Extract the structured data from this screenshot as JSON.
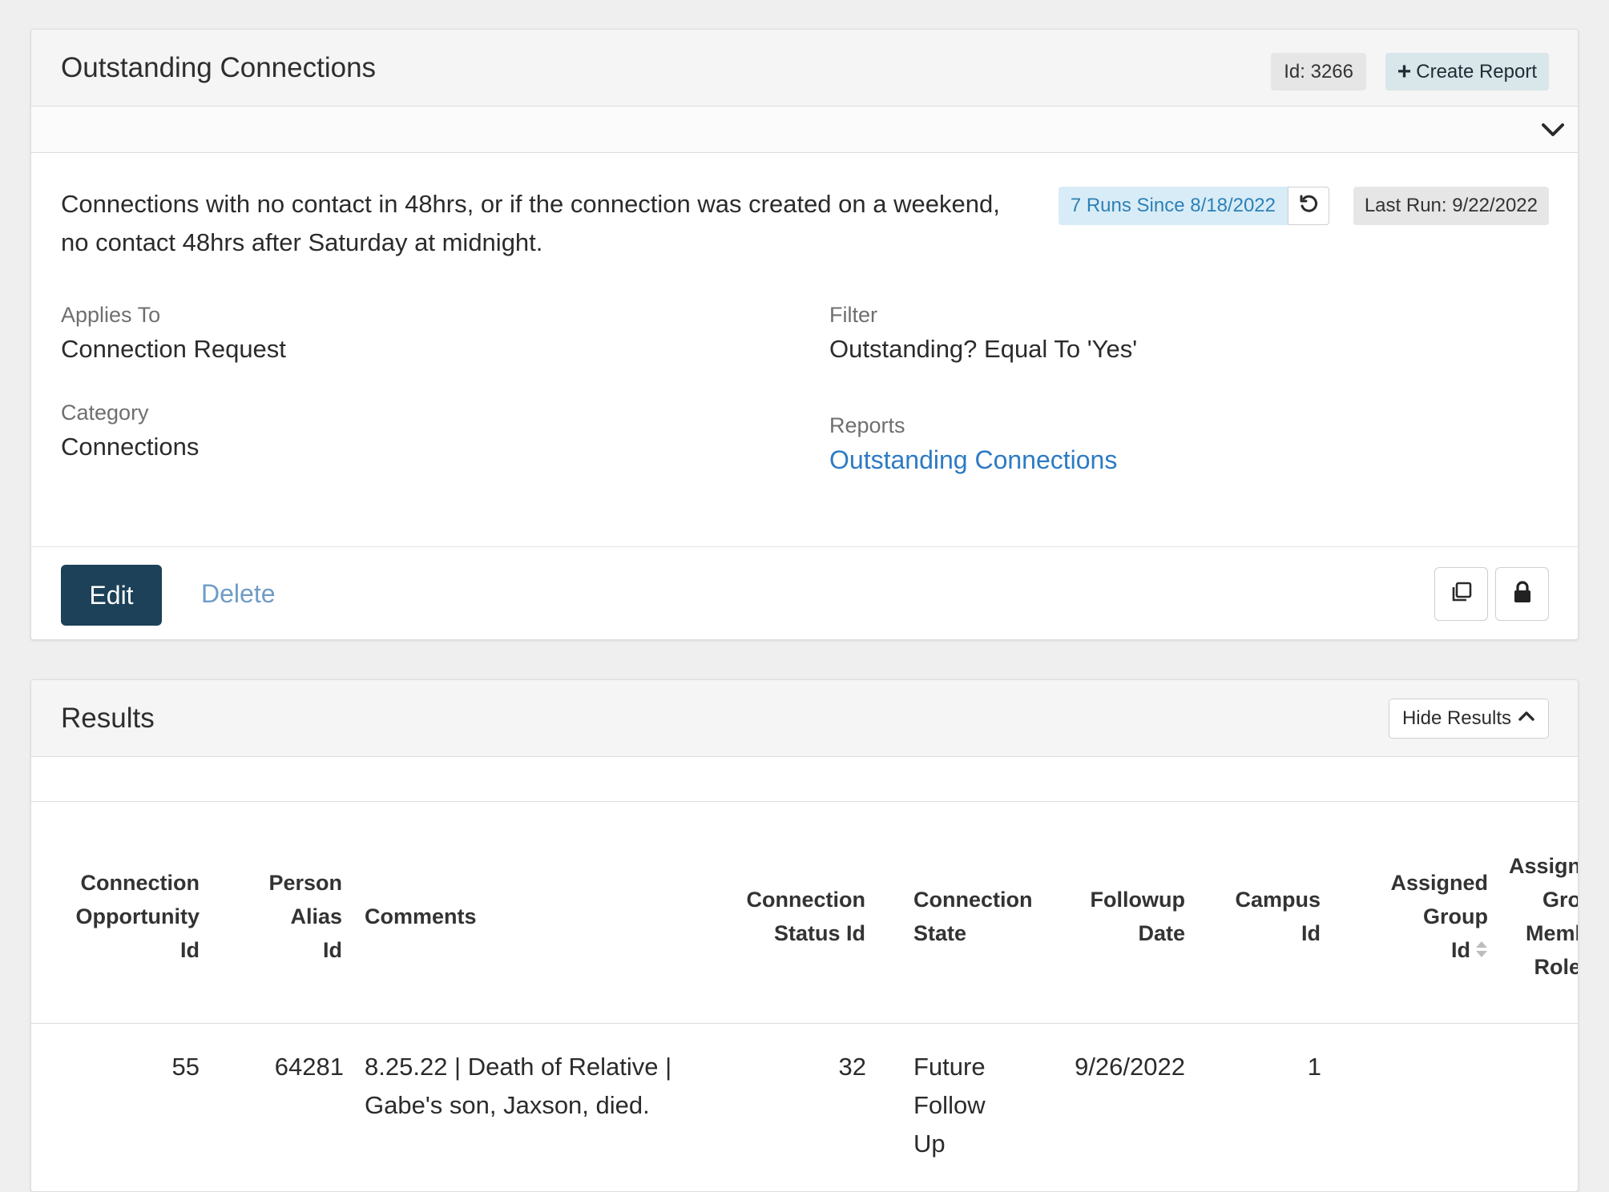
{
  "report_panel": {
    "title": "Outstanding Connections",
    "id_label": "Id: 3266",
    "create_report_label": "Create Report",
    "description": "Connections with no contact in 48hrs, or if the connection was created on a weekend, no contact 48hrs after Saturday at midnight.",
    "runs_label": "7 Runs Since 8/18/2022",
    "last_run_label": "Last Run: 9/22/2022",
    "fields": {
      "applies_to": {
        "label": "Applies To",
        "value": "Connection Request"
      },
      "category": {
        "label": "Category",
        "value": "Connections"
      },
      "filter": {
        "label": "Filter",
        "value": "Outstanding? Equal To 'Yes'"
      },
      "reports": {
        "label": "Reports",
        "value": "Outstanding Connections"
      }
    },
    "actions": {
      "edit_label": "Edit",
      "delete_label": "Delete"
    },
    "icons": {
      "create": "plus-icon",
      "drawer": "chevron-down-icon",
      "refresh": "refresh-icon",
      "copy": "copy-icon",
      "security": "lock-icon"
    }
  },
  "results_panel": {
    "title": "Results",
    "hide_results_label": "Hide Results",
    "columns": [
      {
        "lines": [
          "Connection",
          "Opportunity",
          "Id"
        ]
      },
      {
        "lines": [
          "Person",
          "Alias",
          "Id"
        ]
      },
      {
        "lines": [
          "Comments"
        ]
      },
      {
        "lines": [
          "Connection",
          "Status Id"
        ]
      },
      {
        "lines": [
          "Connection",
          "State"
        ]
      },
      {
        "lines": [
          "Followup",
          "Date"
        ]
      },
      {
        "lines": [
          "Campus",
          "Id"
        ]
      },
      {
        "lines": [
          "Assigned",
          "Group",
          "Id"
        ]
      },
      {
        "lines": [
          "Assign",
          "Gro",
          "Meml",
          "Role"
        ]
      }
    ],
    "rows": [
      {
        "connection_opportunity_id": "55",
        "person_alias_id": "64281",
        "comments": [
          "8.25.22 | Death of Relative |",
          "Gabe's son, Jaxson, died."
        ],
        "connection_status_id": "32",
        "connection_state": [
          "Future",
          "Follow",
          "Up"
        ],
        "followup_date": "9/26/2022",
        "campus_id": "1"
      }
    ]
  },
  "colors": {
    "primary": "#1c4158",
    "link": "#2d7bc4",
    "info_bg": "#d8ecf7",
    "info_text": "#2d80b5"
  }
}
